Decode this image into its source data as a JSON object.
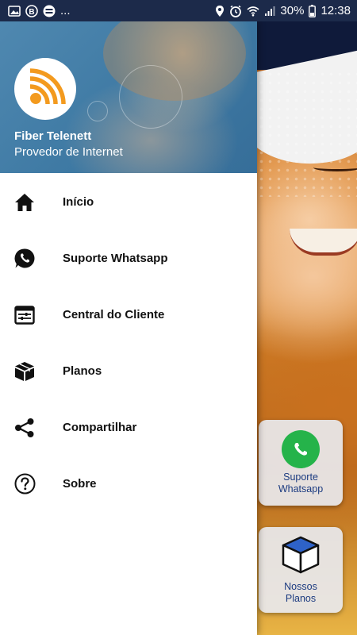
{
  "status_bar": {
    "left_icons": [
      "image-icon",
      "b-badge-icon",
      "circle-e-icon"
    ],
    "more": "...",
    "battery": "30%",
    "time": "12:38"
  },
  "drawer": {
    "header": {
      "title": "Fiber Telenett",
      "subtitle": "Provedor de Internet"
    },
    "items": [
      {
        "label": "Início",
        "icon": "home-icon"
      },
      {
        "label": "Suporte Whatsapp",
        "icon": "whatsapp-icon"
      },
      {
        "label": "Central do Cliente",
        "icon": "control-panel-icon"
      },
      {
        "label": "Planos",
        "icon": "box-icon"
      },
      {
        "label": "Compartilhar",
        "icon": "share-icon"
      },
      {
        "label": "Sobre",
        "icon": "help-icon"
      }
    ]
  },
  "background": {
    "cards": [
      {
        "label": "Suporte\nWhatsapp",
        "icon": "whatsapp-icon"
      },
      {
        "label": "Nossos\nPlanos",
        "icon": "box-icon"
      }
    ]
  },
  "colors": {
    "status_bar": "#1c2a4a",
    "toolbar": "#0f1a3a",
    "logo_orange": "#f39a1e",
    "whatsapp_green": "#25b34a",
    "card_text": "#1c3b80"
  }
}
